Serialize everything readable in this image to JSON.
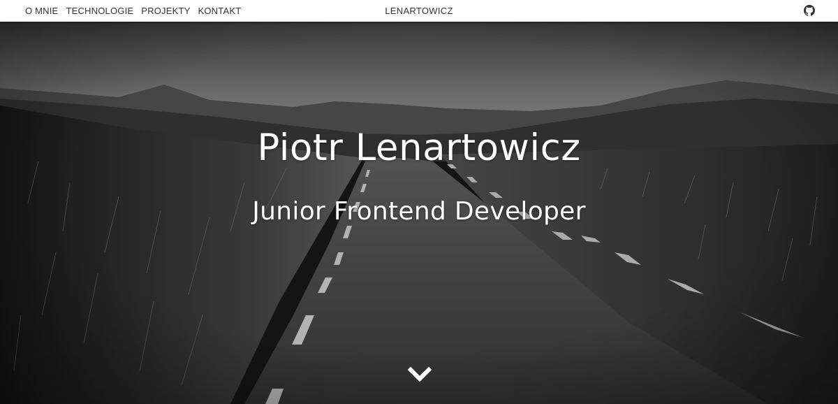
{
  "nav": {
    "links": [
      {
        "label": "O MNIE"
      },
      {
        "label": "TECHNOLOGIE"
      },
      {
        "label": "PROJEKTY"
      },
      {
        "label": "KONTAKT"
      }
    ],
    "brand": "LENARTOWICZ",
    "github_icon": "github-icon"
  },
  "hero": {
    "title": "Piotr Lenartowicz",
    "subtitle": "Junior Frontend Developer",
    "scroll_icon": "chevron-down-icon",
    "background": "grayscale road through grassland with hills"
  },
  "colors": {
    "nav_bg": "#ffffff",
    "nav_text": "#333333",
    "hero_text": "#ffffff"
  }
}
